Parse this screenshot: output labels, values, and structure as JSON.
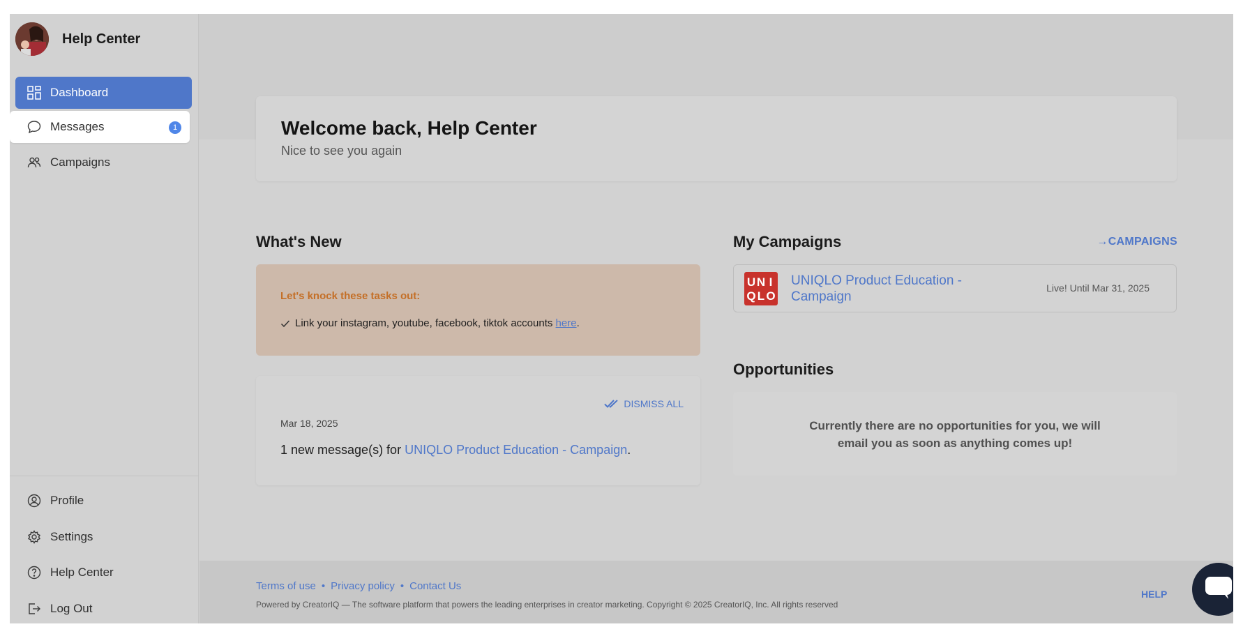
{
  "sidebar": {
    "brand_name": "Help Center",
    "nav_top": [
      {
        "label": "Dashboard",
        "icon": "dashboard-icon"
      },
      {
        "label": "Messages",
        "icon": "chat-icon",
        "badge": "1"
      },
      {
        "label": "Campaigns",
        "icon": "users-icon"
      }
    ],
    "nav_bottom": [
      {
        "label": "Profile",
        "icon": "user-circle-icon"
      },
      {
        "label": "Settings",
        "icon": "gear-icon"
      },
      {
        "label": "Help Center",
        "icon": "question-icon"
      },
      {
        "label": "Log Out",
        "icon": "logout-icon"
      }
    ]
  },
  "welcome": {
    "title": "Welcome back, Help Center",
    "subtitle": "Nice to see you again"
  },
  "whats_new": {
    "title": "What's New",
    "tasks_heading": "Let's knock these tasks out:",
    "task_text": "Link your instagram, youtube, facebook, tiktok accounts ",
    "task_link": "here",
    "task_end": ".",
    "dismiss_label": "DISMISS ALL",
    "message_date": "Mar 18, 2025",
    "message_prefix": "1 new message(s) for ",
    "message_link": "UNIQLO Product Education - Campaign",
    "message_end": "."
  },
  "my_campaigns": {
    "title": "My Campaigns",
    "link_label": "CAMPAIGNS",
    "campaign": {
      "logo_letters": [
        "U",
        "N",
        "I",
        "Q",
        "L",
        "O"
      ],
      "name": "UNIQLO Product Education - Campaign",
      "status": "Live! Until Mar 31, 2025"
    }
  },
  "opportunities": {
    "title": "Opportunities",
    "empty_text": "Currently there are no opportunities for you, we will email you as soon as anything comes up!"
  },
  "footer": {
    "links": [
      "Terms of use",
      "Privacy policy",
      "Contact Us"
    ],
    "copyright": "Powered by CreatorIQ — The software platform that powers the leading enterprises in creator marketing. Copyright © 2025 CreatorIQ, Inc. All rights reserved",
    "help_label": "HELP"
  },
  "colors": {
    "accent": "#4f77c9",
    "tasks_heading": "#c46f27",
    "uniqlo_red": "#c8322c",
    "chat_button": "#1a2336"
  }
}
